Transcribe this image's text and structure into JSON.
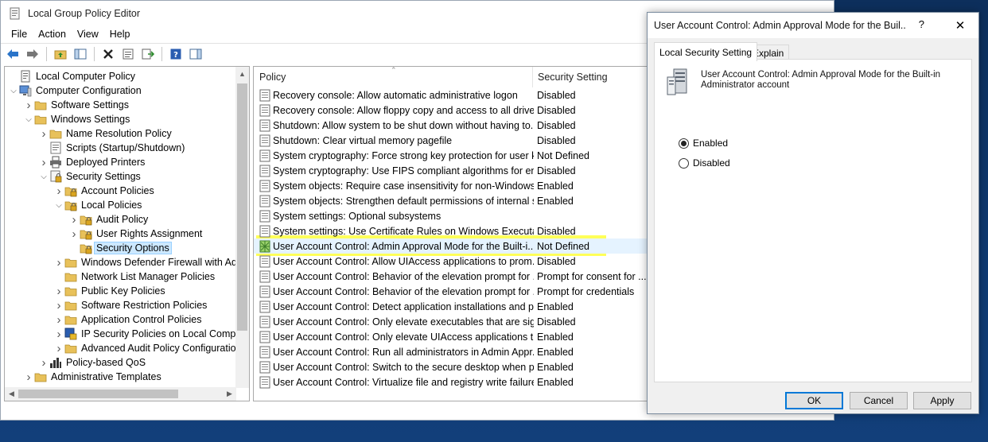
{
  "main_window": {
    "title": "Local Group Policy Editor",
    "menu": [
      "File",
      "Action",
      "View",
      "Help"
    ],
    "caption_buttons": [
      "minimize",
      "maximize",
      "close"
    ]
  },
  "toolbar": {
    "buttons": [
      "back-icon",
      "forward-icon",
      "up-folder-icon",
      "show-hide-tree-icon",
      "delete-icon",
      "properties-icon",
      "export-list-icon",
      "help-icon",
      "show-pane-icon"
    ]
  },
  "tree": {
    "items": [
      {
        "label": "Local Computer Policy",
        "level": 0,
        "expander": "",
        "icon": "computer-policy-icon"
      },
      {
        "label": "Computer Configuration",
        "level": 0,
        "expander": "open",
        "icon": "computer-icon"
      },
      {
        "label": "Software Settings",
        "level": 1,
        "expander": "closed",
        "icon": "folder-icon"
      },
      {
        "label": "Windows Settings",
        "level": 1,
        "expander": "open",
        "icon": "folder-icon"
      },
      {
        "label": "Name Resolution Policy",
        "level": 2,
        "expander": "closed",
        "icon": "folder-icon"
      },
      {
        "label": "Scripts (Startup/Shutdown)",
        "level": 2,
        "expander": "",
        "icon": "script-icon"
      },
      {
        "label": "Deployed Printers",
        "level": 2,
        "expander": "closed",
        "icon": "printer-icon"
      },
      {
        "label": "Security Settings",
        "level": 2,
        "expander": "open",
        "icon": "security-icon"
      },
      {
        "label": "Account Policies",
        "level": 3,
        "expander": "closed",
        "icon": "lock-folder-icon"
      },
      {
        "label": "Local Policies",
        "level": 3,
        "expander": "open",
        "icon": "lock-folder-icon"
      },
      {
        "label": "Audit Policy",
        "level": 4,
        "expander": "closed",
        "icon": "lock-folder-icon"
      },
      {
        "label": "User Rights Assignment",
        "level": 4,
        "expander": "closed",
        "icon": "lock-folder-icon"
      },
      {
        "label": "Security Options",
        "level": 4,
        "expander": "",
        "icon": "lock-folder-icon",
        "selected": true
      },
      {
        "label": "Windows Defender Firewall with Adv",
        "level": 3,
        "expander": "closed",
        "icon": "folder-icon"
      },
      {
        "label": "Network List Manager Policies",
        "level": 3,
        "expander": "",
        "icon": "folder-icon"
      },
      {
        "label": "Public Key Policies",
        "level": 3,
        "expander": "closed",
        "icon": "folder-icon"
      },
      {
        "label": "Software Restriction Policies",
        "level": 3,
        "expander": "closed",
        "icon": "folder-icon"
      },
      {
        "label": "Application Control Policies",
        "level": 3,
        "expander": "closed",
        "icon": "folder-icon"
      },
      {
        "label": "IP Security Policies on Local Compu",
        "level": 3,
        "expander": "closed",
        "icon": "ip-security-icon"
      },
      {
        "label": "Advanced Audit Policy Configuratio",
        "level": 3,
        "expander": "closed",
        "icon": "folder-icon"
      },
      {
        "label": "Policy-based QoS",
        "level": 2,
        "expander": "closed",
        "icon": "chart-icon"
      },
      {
        "label": "Administrative Templates",
        "level": 1,
        "expander": "closed",
        "icon": "folder-icon"
      }
    ]
  },
  "list": {
    "columns": [
      "Policy",
      "Security Setting"
    ],
    "rows": [
      {
        "policy": "Recovery console: Allow automatic administrative logon",
        "setting": "Disabled"
      },
      {
        "policy": "Recovery console: Allow floppy copy and access to all drives...",
        "setting": "Disabled"
      },
      {
        "policy": "Shutdown: Allow system to be shut down without having to...",
        "setting": "Disabled"
      },
      {
        "policy": "Shutdown: Clear virtual memory pagefile",
        "setting": "Disabled"
      },
      {
        "policy": "System cryptography: Force strong key protection for user k...",
        "setting": "Not Defined"
      },
      {
        "policy": "System cryptography: Use FIPS compliant algorithms for en...",
        "setting": "Disabled"
      },
      {
        "policy": "System objects: Require case insensitivity for non-Windows ...",
        "setting": "Enabled"
      },
      {
        "policy": "System objects: Strengthen default permissions of internal s...",
        "setting": "Enabled"
      },
      {
        "policy": "System settings: Optional subsystems",
        "setting": ""
      },
      {
        "policy": "System settings: Use Certificate Rules on Windows Executabl...",
        "setting": "Disabled"
      },
      {
        "policy": "User Account Control: Admin Approval Mode for the Built-i...",
        "setting": "Not Defined",
        "selected": true
      },
      {
        "policy": "User Account Control: Allow UIAccess applications to prom...",
        "setting": "Disabled"
      },
      {
        "policy": "User Account Control: Behavior of the elevation prompt for ...",
        "setting": "Prompt for consent for ..."
      },
      {
        "policy": "User Account Control: Behavior of the elevation prompt for ...",
        "setting": "Prompt for credentials"
      },
      {
        "policy": "User Account Control: Detect application installations and p...",
        "setting": "Enabled"
      },
      {
        "policy": "User Account Control: Only elevate executables that are sign...",
        "setting": "Disabled"
      },
      {
        "policy": "User Account Control: Only elevate UIAccess applications th...",
        "setting": "Enabled"
      },
      {
        "policy": "User Account Control: Run all administrators in Admin Appr...",
        "setting": "Enabled"
      },
      {
        "policy": "User Account Control: Switch to the secure desktop when pr...",
        "setting": "Enabled"
      },
      {
        "policy": "User Account Control: Virtualize file and registry write failure...",
        "setting": "Enabled"
      }
    ]
  },
  "dialog": {
    "title": "User Account Control: Admin Approval Mode for the Buil...",
    "help_glyph": "?",
    "close_glyph": "✕",
    "tabs": [
      "Local Security Setting",
      "Explain"
    ],
    "description": "User Account Control: Admin Approval Mode for the Built-in Administrator account",
    "options": [
      {
        "label": "Enabled",
        "checked": true
      },
      {
        "label": "Disabled",
        "checked": false
      }
    ],
    "buttons": {
      "ok": "OK",
      "cancel": "Cancel",
      "apply": "Apply"
    }
  },
  "colors": {
    "selection": "#cce8ff",
    "highlight": "#ffff2a",
    "folder": "#e8c15a",
    "accent": "#0078d7"
  }
}
